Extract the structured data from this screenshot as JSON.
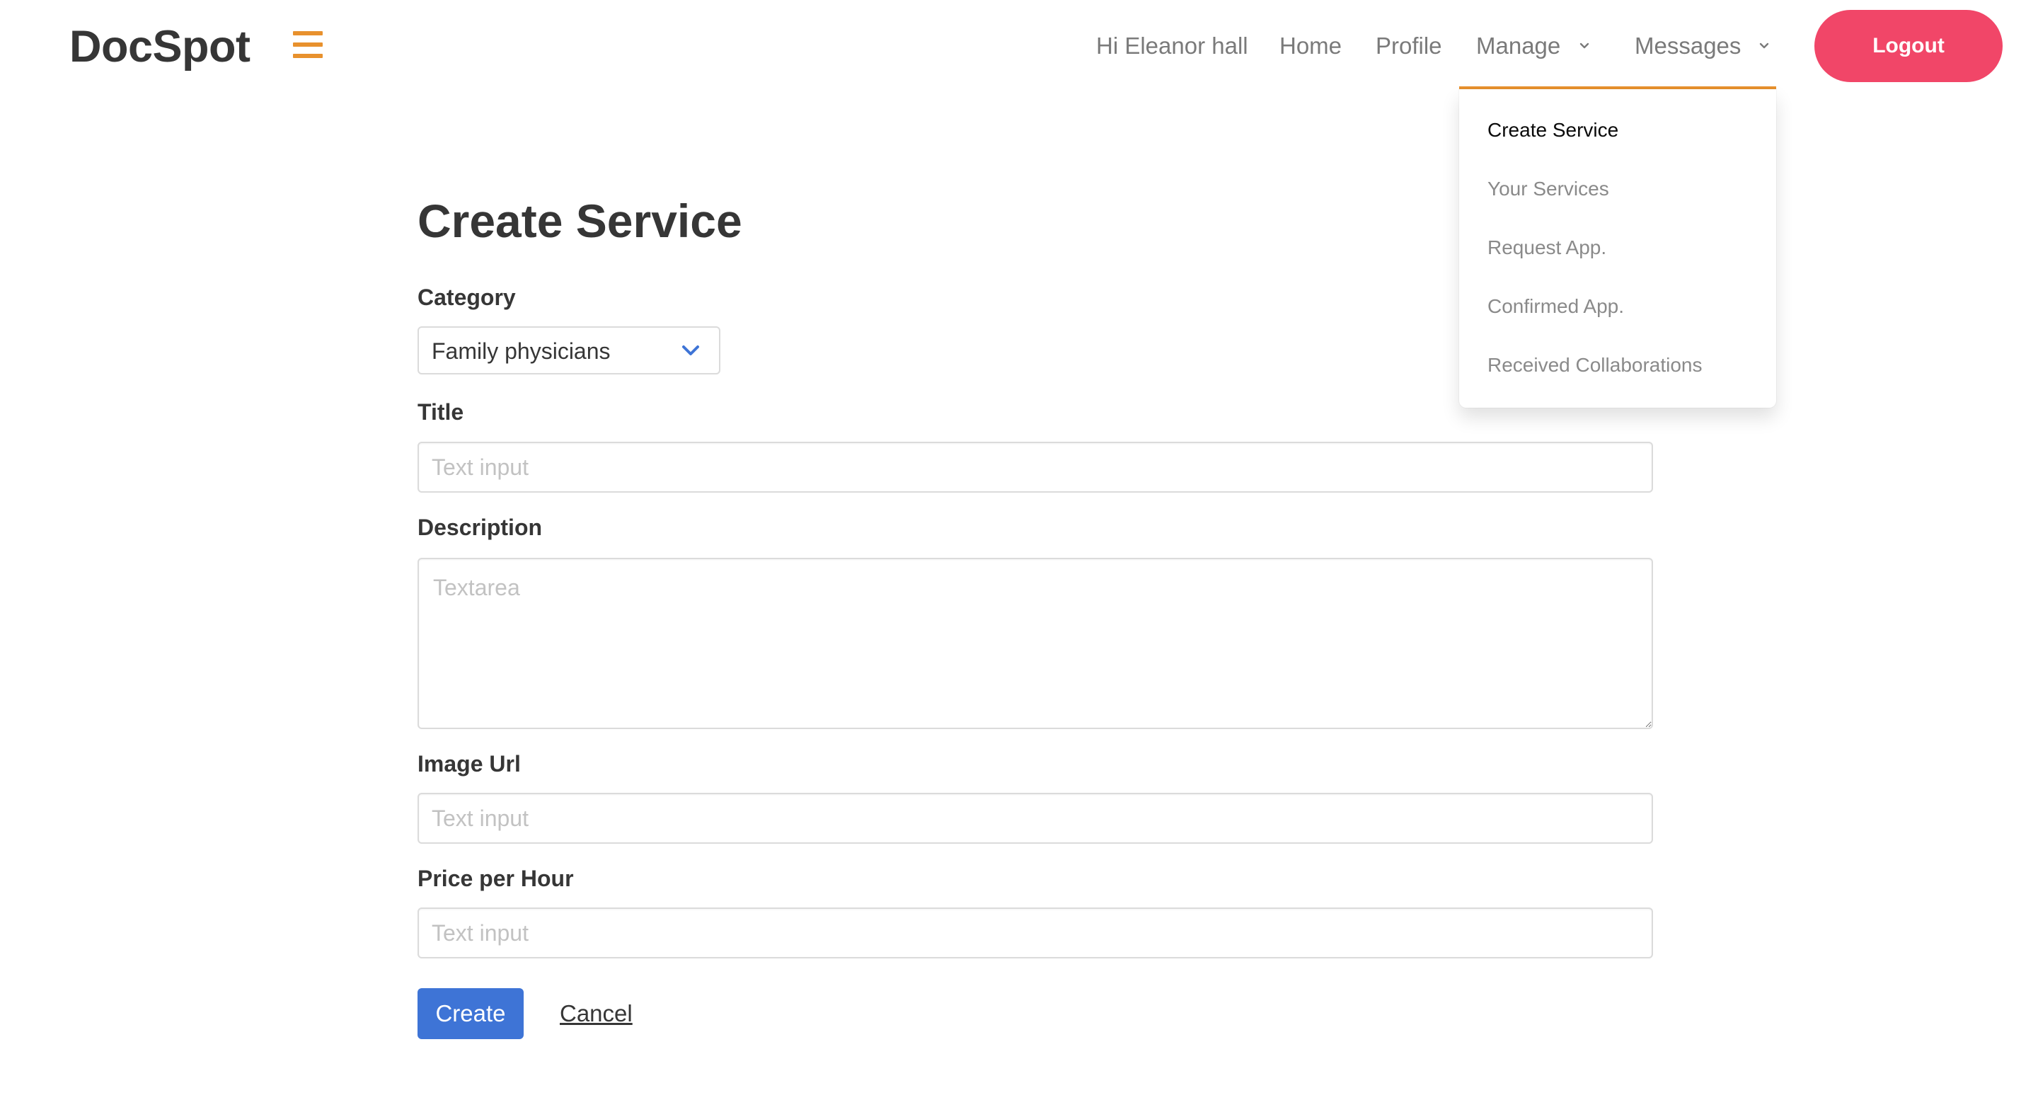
{
  "navbar": {
    "brand": "DocSpot",
    "greeting": "Hi Eleanor hall",
    "links": {
      "home": "Home",
      "profile": "Profile",
      "manage": "Manage",
      "messages": "Messages"
    },
    "logout_label": "Logout",
    "accent_color": "#e8912d",
    "logout_color": "#f14668"
  },
  "manage_menu": {
    "items": [
      {
        "label": "Create Service",
        "active": true
      },
      {
        "label": "Your Services",
        "active": false
      },
      {
        "label": "Request App.",
        "active": false
      },
      {
        "label": "Confirmed App.",
        "active": false
      },
      {
        "label": "Received Collaborations",
        "active": false
      }
    ]
  },
  "form": {
    "title": "Create Service",
    "category": {
      "label": "Category",
      "selected": "Family physicians"
    },
    "title_field": {
      "label": "Title",
      "placeholder": "Text input"
    },
    "description": {
      "label": "Description",
      "placeholder": "Textarea"
    },
    "image_url": {
      "label": "Image Url",
      "placeholder": "Text input"
    },
    "price": {
      "label": "Price per Hour",
      "placeholder": "Text input"
    },
    "create_label": "Create",
    "cancel_label": "Cancel",
    "primary_color": "#3e74d6"
  }
}
